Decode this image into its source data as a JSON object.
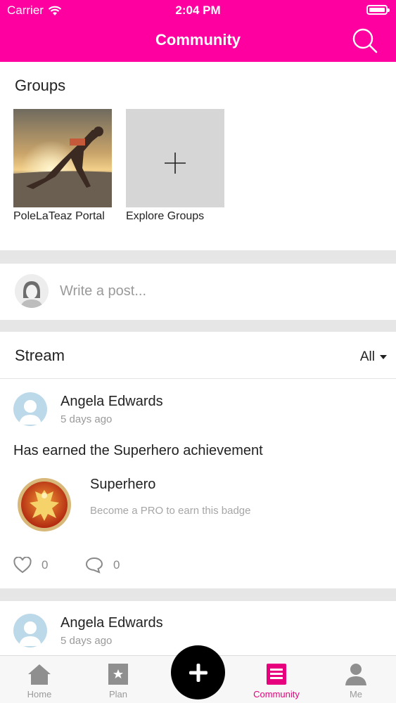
{
  "status_bar": {
    "carrier": "Carrier",
    "time": "2:04 PM"
  },
  "header": {
    "title": "Community",
    "search_icon": "search-icon"
  },
  "groups": {
    "title": "Groups",
    "items": [
      {
        "label": "PoleLaTeaz Portal"
      },
      {
        "label": "Explore Groups"
      }
    ]
  },
  "composer": {
    "placeholder": "Write a post..."
  },
  "stream": {
    "title": "Stream",
    "filter": "All",
    "posts": [
      {
        "author": "Angela Edwards",
        "time": "5 days ago",
        "text": "Has earned the Superhero achievement",
        "badge_title": "Superhero",
        "badge_subtitle": "Become a PRO to earn this badge",
        "likes": "0",
        "comments": "0"
      },
      {
        "author": "Angela Edwards",
        "time": "5 days ago"
      }
    ]
  },
  "tabs": [
    {
      "label": "Home",
      "icon": "home-icon"
    },
    {
      "label": "Plan",
      "icon": "plan-star-icon"
    },
    {
      "label": "Community",
      "icon": "community-icon",
      "active": true
    },
    {
      "label": "Me",
      "icon": "person-icon"
    }
  ],
  "colors": {
    "brand": "#ff00a0",
    "active_tab": "#e6007e"
  }
}
